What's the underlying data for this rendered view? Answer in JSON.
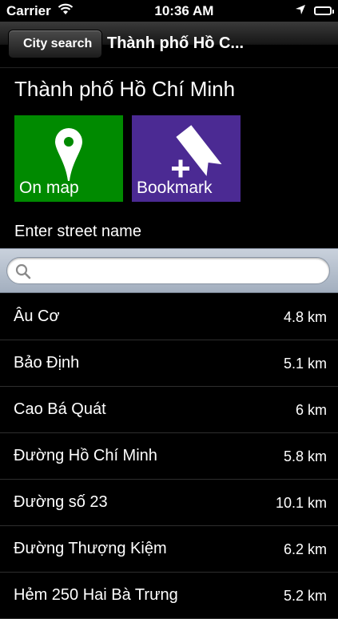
{
  "status_bar": {
    "carrier": "Carrier",
    "time": "10:36 AM"
  },
  "nav": {
    "back_label": "City search",
    "title": "Thành phố Hồ C..."
  },
  "city": {
    "name": "Thành phố Hồ Chí Minh"
  },
  "tiles": {
    "map_label": "On map",
    "bookmark_label": "Bookmark",
    "map_color": "#008a00",
    "bookmark_color": "#4b2a93"
  },
  "street": {
    "label": "Enter street name",
    "search_value": "",
    "search_placeholder": ""
  },
  "streets": [
    {
      "name": "Âu Cơ",
      "distance": "4.8 km"
    },
    {
      "name": "Bảo Định",
      "distance": "5.1 km"
    },
    {
      "name": "Cao Bá Quát",
      "distance": "6 km"
    },
    {
      "name": "Đường Hồ Chí Minh",
      "distance": "5.8 km"
    },
    {
      "name": "Đường số 23",
      "distance": "10.1 km"
    },
    {
      "name": "Đường Thượng Kiệm",
      "distance": "6.2 km"
    },
    {
      "name": "Hẻm 250 Hai Bà Trưng",
      "distance": "5.2 km"
    }
  ]
}
